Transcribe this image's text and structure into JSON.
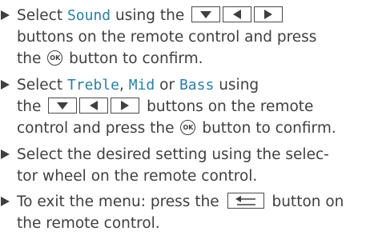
{
  "steps": [
    {
      "l1a": "Select ",
      "l1b": "Sound",
      "l1c": " using the",
      "l2": "buttons on the remote control and press",
      "l3a": "the",
      "l3b": "button to confirm."
    },
    {
      "l1a": "Select ",
      "l1b": "Treble",
      "l1c": ", ",
      "l1d": "Mid",
      "l1e": " or ",
      "l1f": "Bass",
      "l1g": " using",
      "l2a": "the",
      "l2b": "buttons on the remote",
      "l3a": "control and press the",
      "l3b": "button to confirm."
    },
    {
      "l1": "Select the desired setting using the selec-",
      "l2": "tor wheel on the remote control."
    },
    {
      "l1a": "To exit the menu: press the",
      "l1b": "button on",
      "l2": "the remote control."
    }
  ],
  "icons": {
    "down": "down-arrow-key-icon",
    "left": "left-arrow-key-icon",
    "right": "right-arrow-key-icon",
    "ok": "OK",
    "back": "back-key-icon"
  }
}
